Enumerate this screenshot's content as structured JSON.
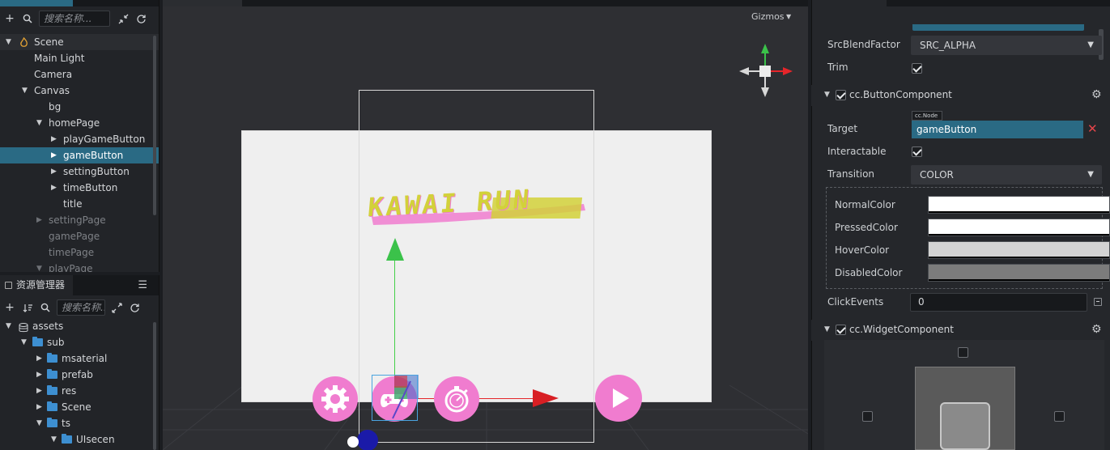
{
  "hierarchy": {
    "search_placeholder": "搜索名称...",
    "nodes": [
      {
        "label": "Scene"
      },
      {
        "label": "Main Light"
      },
      {
        "label": "Camera"
      },
      {
        "label": "Canvas"
      },
      {
        "label": "bg"
      },
      {
        "label": "homePage"
      },
      {
        "label": "playGameButton"
      },
      {
        "label": "gameButton"
      },
      {
        "label": "settingButton"
      },
      {
        "label": "timeButton"
      },
      {
        "label": "title"
      },
      {
        "label": "settingPage"
      },
      {
        "label": "gamePage"
      },
      {
        "label": "timePage"
      },
      {
        "label": "playPage"
      }
    ]
  },
  "assets": {
    "title": "资源管理器",
    "search_placeholder": "搜索名称...",
    "nodes": [
      {
        "label": "assets"
      },
      {
        "label": "sub"
      },
      {
        "label": "msaterial"
      },
      {
        "label": "prefab"
      },
      {
        "label": "res"
      },
      {
        "label": "Scene"
      },
      {
        "label": "ts"
      },
      {
        "label": "UIsecen"
      }
    ]
  },
  "scene": {
    "gizmos_label": "Gizmos",
    "logo_text": "KAWAI RUN",
    "colors": {
      "button_pink": "#f07ccf",
      "logo_yellow": "#d2d13a",
      "axis_green": "#44d04a",
      "axis_red": "#e5252a"
    }
  },
  "inspector": {
    "src_blend_label": "SrcBlendFactor",
    "src_blend_value": "SRC_ALPHA",
    "trim_label": "Trim",
    "button_component": "cc.ButtonComponent",
    "target_label": "Target",
    "target_tag": "cc.Node",
    "target_value": "gameButton",
    "interactable_label": "Interactable",
    "transition_label": "Transition",
    "transition_value": "COLOR",
    "normal_color_label": "NormalColor",
    "pressed_color_label": "PressedColor",
    "hover_color_label": "HoverColor",
    "disabled_color_label": "DisabledColor",
    "colors": {
      "normal": "#ffffff",
      "pressed": "#ffffff",
      "hover": "#d3d3d3",
      "disabled": "#7c7c7c"
    },
    "click_events_label": "ClickEvents",
    "click_events_value": "0",
    "widget_component": "cc.WidgetComponent"
  }
}
